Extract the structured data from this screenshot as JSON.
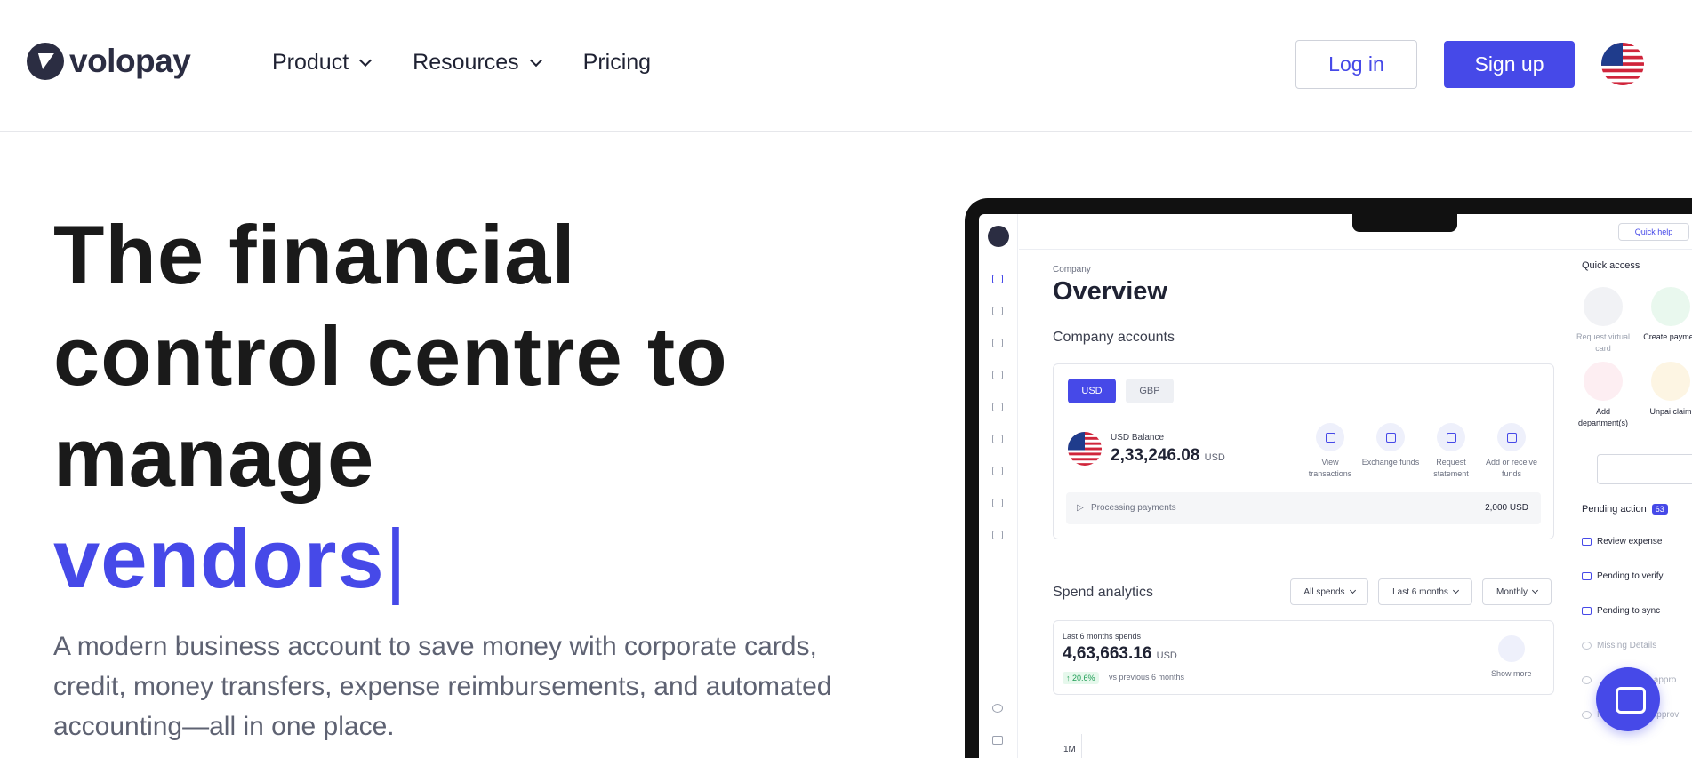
{
  "brand": {
    "name": "volopay"
  },
  "nav": {
    "items": [
      {
        "label": "Product",
        "has_dropdown": true
      },
      {
        "label": "Resources",
        "has_dropdown": true
      },
      {
        "label": "Pricing",
        "has_dropdown": false
      }
    ],
    "login_label": "Log in",
    "signup_label": "Sign up",
    "region_icon": "us-flag-icon"
  },
  "hero": {
    "title_lines": [
      "The financial",
      "control centre to",
      "manage"
    ],
    "title_accent": "vendors",
    "cursor": "|",
    "subtitle": "A modern business account to save money with corporate cards, credit, money transfers, expense reimbursements, and automated accounting—all in one place."
  },
  "dashboard": {
    "quick_help": "Quick help",
    "breadcrumb": "Company",
    "title": "Overview",
    "accounts_heading": "Company accounts",
    "currency_tabs": [
      "USD",
      "GBP"
    ],
    "balance_label": "USD Balance",
    "balance_value": "2,33,246.08",
    "balance_unit": "USD",
    "actions": [
      {
        "label": "View transactions"
      },
      {
        "label": "Exchange funds"
      },
      {
        "label": "Request statement"
      },
      {
        "label": "Add or receive funds"
      }
    ],
    "processing_label": "Processing payments",
    "processing_value": "2,000 USD",
    "spend_heading": "Spend analytics",
    "filters": [
      "All spends",
      "Last 6 months",
      "Monthly"
    ],
    "spend_label": "Last 6 months spends",
    "spend_value": "4,63,663.16",
    "spend_unit": "USD",
    "spend_growth": "20.6%",
    "spend_compare": "vs previous 6 months",
    "show_more": "Show more",
    "chart_tick": "1M",
    "quick_access": {
      "heading": "Quick access",
      "items": [
        {
          "label": "Request virtual card"
        },
        {
          "label": "Create paymen"
        },
        {
          "label": "Add department(s)"
        },
        {
          "label": "Unpai claim"
        }
      ]
    },
    "pending": {
      "heading": "Pending action",
      "count": "63",
      "items": [
        {
          "label": "Review expense",
          "dim": false
        },
        {
          "label": "Pending to verify",
          "dim": false
        },
        {
          "label": "Pending to sync",
          "dim": false
        },
        {
          "label": "Missing Details",
          "dim": true
        },
        {
          "label": "y appro",
          "dim": true
        },
        {
          "label": "Pending card approv",
          "dim": true
        }
      ]
    }
  },
  "colors": {
    "accent": "#4649e8",
    "dark": "#1a1a1a",
    "muted": "#5e6272"
  }
}
